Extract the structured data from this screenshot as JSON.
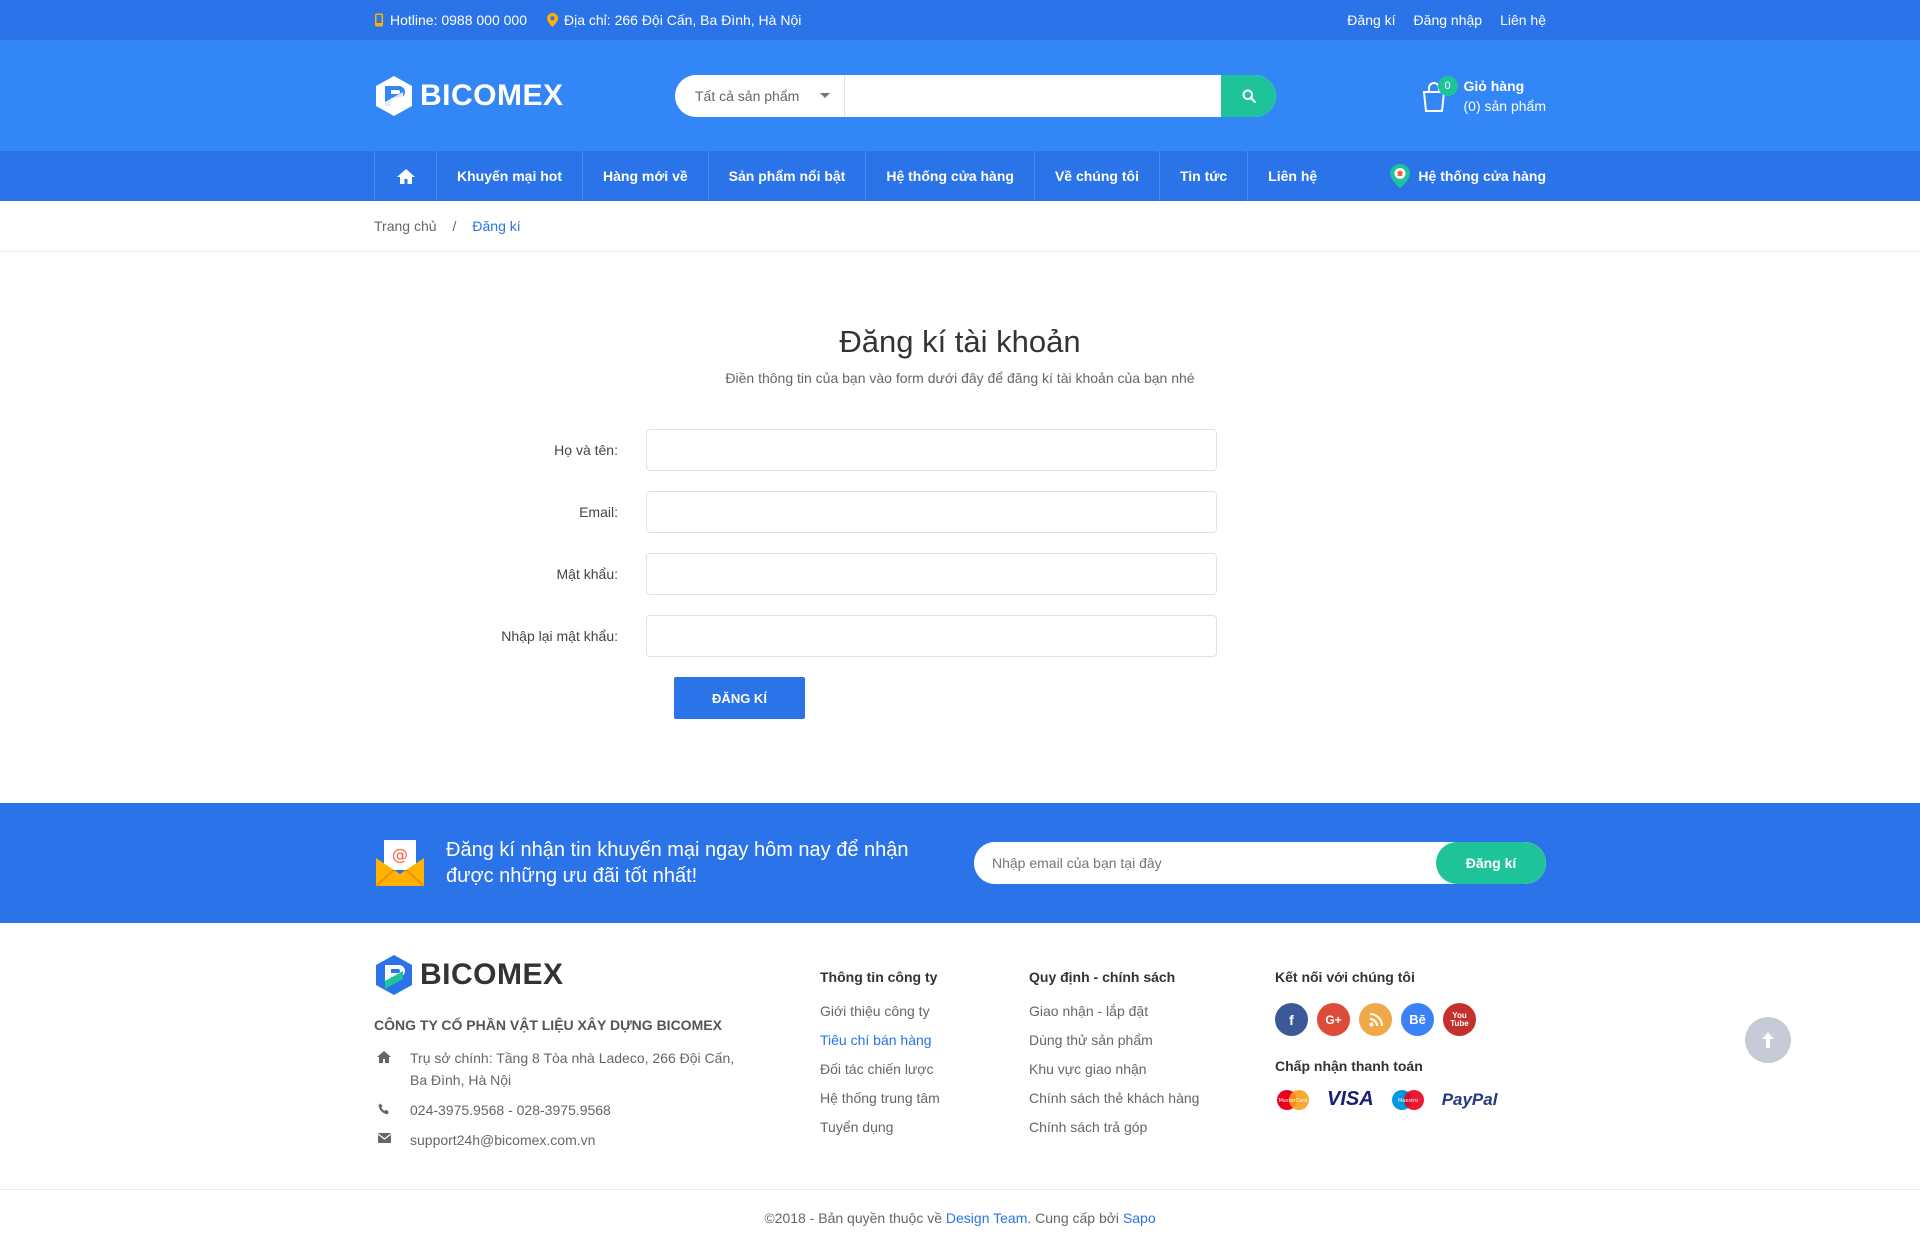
{
  "topbar": {
    "hotline": "Hotline: 0988 000 000",
    "address": "Địa chỉ: 266 Đội Cấn, Ba Đình, Hà Nội",
    "links": [
      "Đăng kí",
      "Đăng nhập",
      "Liên hệ"
    ]
  },
  "header": {
    "logo_text": "BICOMEX",
    "search_category": "Tất cả sản phẩm",
    "search_placeholder": "",
    "cart_count": "0",
    "cart_title": "Giỏ hàng",
    "cart_items": "(0) sản phẩm"
  },
  "nav": {
    "items": [
      "Khuyến mại hot",
      "Hàng mới về",
      "Sản phẩm nổi bật",
      "Hệ thống cửa hàng",
      "Về chúng tôi",
      "Tin tức",
      "Liên hệ"
    ],
    "store_link": "Hệ thống cửa hàng"
  },
  "breadcrumb": {
    "home": "Trang chủ",
    "sep": "/",
    "current": "Đăng kí"
  },
  "form": {
    "title": "Đăng kí tài khoản",
    "subtitle": "Điền thông tin của bạn vào form dưới đây để đăng kí tài khoản của bạn nhé",
    "fields": [
      "Họ và tên:",
      "Email:",
      "Mật khẩu:",
      "Nhập lại mật khẩu:"
    ],
    "submit": "ĐĂNG KÍ"
  },
  "newsletter": {
    "text": "Đăng kí nhận tin khuyến mại ngay hôm nay để nhận được những ưu đãi tốt nhất!",
    "placeholder": "Nhập email của bạn tại đây",
    "button": "Đăng kí"
  },
  "footer": {
    "logo_text": "BICOMEX",
    "company": "CÔNG TY CỔ PHẦN VẬT LIỆU XÂY DỰNG BICOMEX",
    "address": "Trụ sở chính: Tầng 8 Tòa nhà Ladeco, 266 Đội Cấn, Ba Đình, Hà Nội",
    "phone": "024-3975.9568 - 028-3975.9568",
    "email": "support24h@bicomex.com.vn",
    "col1_title": "Thông tin công ty",
    "col1_items": [
      "Giới thiệu công ty",
      "Tiêu chí bán hàng",
      "Đối tác chiến lược",
      "Hệ thống trung tâm",
      "Tuyển dụng"
    ],
    "col2_title": "Quy định - chính sách",
    "col2_items": [
      "Giao nhận - lắp đặt",
      "Dùng thử sản phẩm",
      "Khu vực giao nhận",
      "Chính sách thẻ khách hàng",
      "Chính sách trả góp"
    ],
    "social_title": "Kết nối với chúng tôi",
    "payment_title": "Chấp nhận thanh toán",
    "social_icons": [
      "facebook-icon",
      "google-plus-icon",
      "rss-icon",
      "behance-icon",
      "youtube-icon"
    ],
    "payment_labels": [
      "MasterCard",
      "VISA",
      "Maestro",
      "PayPal"
    ]
  },
  "copyright": {
    "prefix": "©2018 - Bản quyền thuộc về ",
    "team": "Design Team",
    "middle": ". Cung cấp bởi ",
    "provider": "Sapo"
  },
  "colors": {
    "primary": "#2a73e8",
    "header": "#3386f5",
    "accent": "#1fc39a"
  }
}
